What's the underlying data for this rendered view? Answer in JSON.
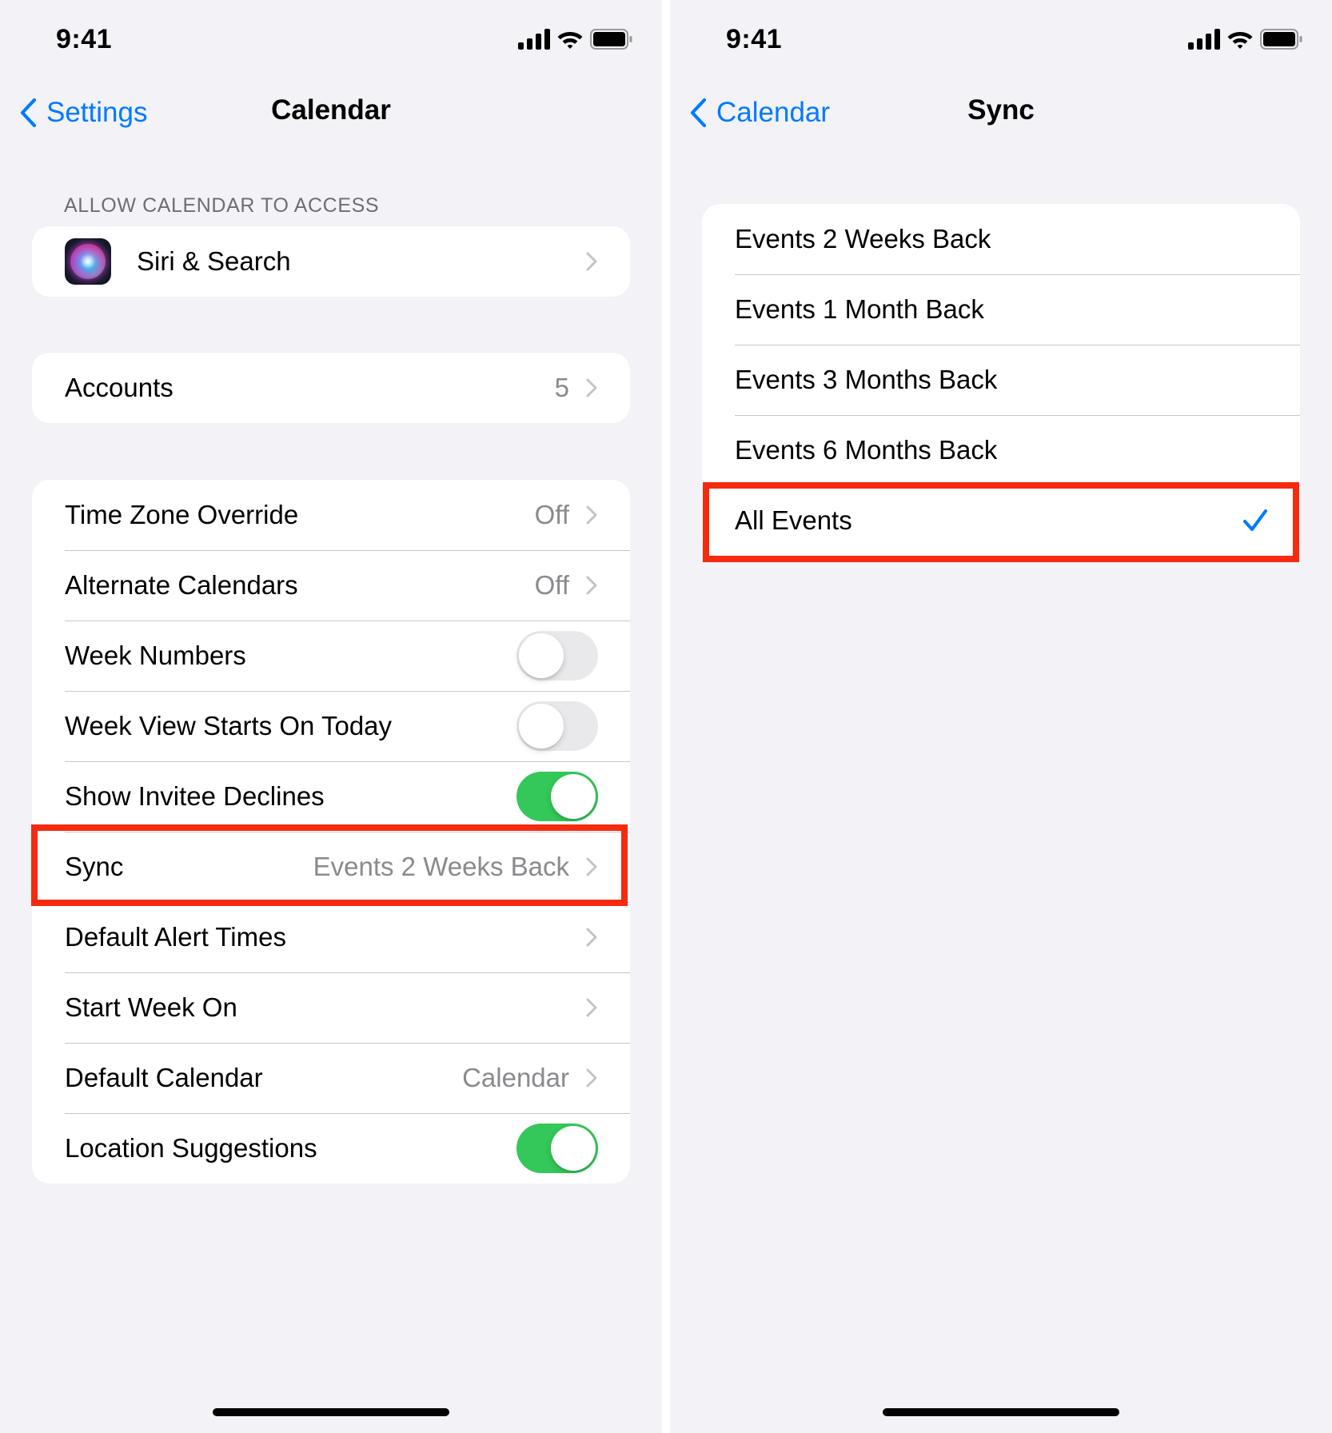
{
  "theme": {
    "accent": "#007aff",
    "toggle_on": "#34c759",
    "toggle_off": "#e9e9eb",
    "highlight": "#f52a0f",
    "background": "#f2f2f7"
  },
  "left_screen": {
    "status_bar": {
      "time": "9:41",
      "icons": [
        "cellular-signal-icon",
        "wifi-icon",
        "battery-icon"
      ]
    },
    "nav": {
      "back_label": "Settings",
      "title": "Calendar"
    },
    "access_section": {
      "header": "ALLOW CALENDAR TO ACCESS",
      "items": [
        {
          "icon": "siri-icon",
          "label": "Siri & Search"
        }
      ]
    },
    "accounts": {
      "label": "Accounts",
      "value": "5"
    },
    "settings": [
      {
        "label": "Time Zone Override",
        "value": "Off",
        "control": "chevron"
      },
      {
        "label": "Alternate Calendars",
        "value": "Off",
        "control": "chevron"
      },
      {
        "label": "Week Numbers",
        "control": "toggle",
        "on": false
      },
      {
        "label": "Week View Starts On Today",
        "control": "toggle",
        "on": false
      },
      {
        "label": "Show Invitee Declines",
        "control": "toggle",
        "on": true
      },
      {
        "label": "Sync",
        "value": "Events 2 Weeks Back",
        "control": "chevron",
        "highlighted": true
      },
      {
        "label": "Default Alert Times",
        "control": "chevron"
      },
      {
        "label": "Start Week On",
        "control": "chevron"
      },
      {
        "label": "Default Calendar",
        "value": "Calendar",
        "control": "chevron"
      },
      {
        "label": "Location Suggestions",
        "control": "toggle",
        "on": true
      }
    ]
  },
  "right_screen": {
    "status_bar": {
      "time": "9:41",
      "icons": [
        "cellular-signal-icon",
        "wifi-icon",
        "battery-icon"
      ]
    },
    "nav": {
      "back_label": "Calendar",
      "title": "Sync"
    },
    "options": [
      {
        "label": "Events 2 Weeks Back",
        "selected": false
      },
      {
        "label": "Events 1 Month Back",
        "selected": false
      },
      {
        "label": "Events 3 Months Back",
        "selected": false
      },
      {
        "label": "Events 6 Months Back",
        "selected": false
      },
      {
        "label": "All Events",
        "selected": true,
        "highlighted": true
      }
    ]
  }
}
